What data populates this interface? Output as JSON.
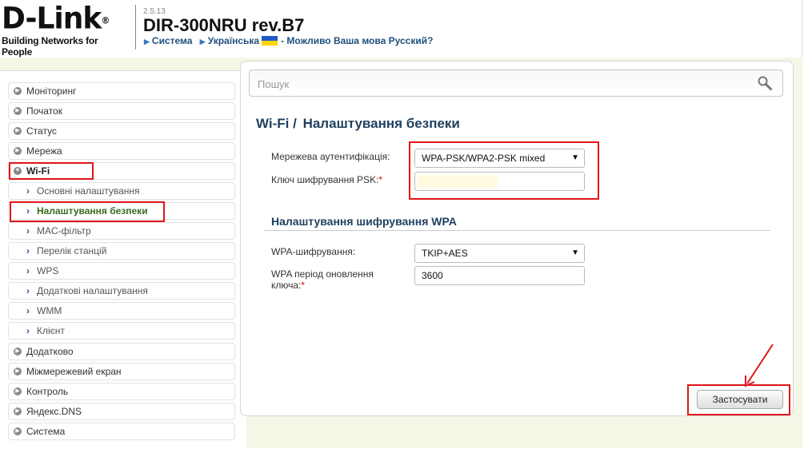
{
  "header": {
    "logo": {
      "brand": "D-Link",
      "registered": "®",
      "tagline": "Building Networks for People"
    },
    "fw_version": "2.5.13",
    "model": "DIR-300NRU rev.B7",
    "breadcrumbs": [
      {
        "label": "Система"
      },
      {
        "label": "Українська"
      },
      {
        "label": "- Можливо Ваша мова Русский?"
      }
    ],
    "flag_colors": [
      "#1e5bc6",
      "#ffd700"
    ]
  },
  "sidebar": {
    "items": [
      {
        "label": "Моніторинг"
      },
      {
        "label": "Початок"
      },
      {
        "label": "Статус"
      },
      {
        "label": "Мережа"
      },
      {
        "label": "Wi-Fi",
        "expanded": true
      },
      {
        "label": "Основні налаштування"
      },
      {
        "label": "Налаштування безпеки",
        "active": true
      },
      {
        "label": "MAC-фільтр"
      },
      {
        "label": "Перелік станцій"
      },
      {
        "label": "WPS"
      },
      {
        "label": "Додаткові налаштування"
      },
      {
        "label": "WMM"
      },
      {
        "label": "Клієнт"
      },
      {
        "label": "Додатково"
      },
      {
        "label": "Міжмережевий екран"
      },
      {
        "label": "Контроль"
      },
      {
        "label": "Яндекс.DNS"
      },
      {
        "label": "Система"
      }
    ]
  },
  "search": {
    "placeholder": "Пошук",
    "value": ""
  },
  "page": {
    "heading_section": "Wi-Fi /",
    "heading_title": "Налаштування безпеки"
  },
  "form": {
    "auth_label": "Мережева аутентифікація:",
    "auth_value": "WPA-PSK/WPA2-PSK mixed",
    "psk_label": "Ключ шифрування PSK:",
    "psk_value": "",
    "required_mark": "*",
    "wpa_section_title": "Налаштування шифрування WPA",
    "wpa_cipher_label": "WPA-шифрування:",
    "wpa_cipher_value": "TKIP+AES",
    "wpa_period_label": "WPA період оновлення ключа:",
    "wpa_period_value": "3600"
  },
  "actions": {
    "apply_label": "Застосувати"
  },
  "colors": {
    "accent_text": "#1f3f5f",
    "active_item": "#3a6a1f",
    "annotation_red": "#e0161a",
    "page_bg_strip": "#f4f7e6"
  }
}
